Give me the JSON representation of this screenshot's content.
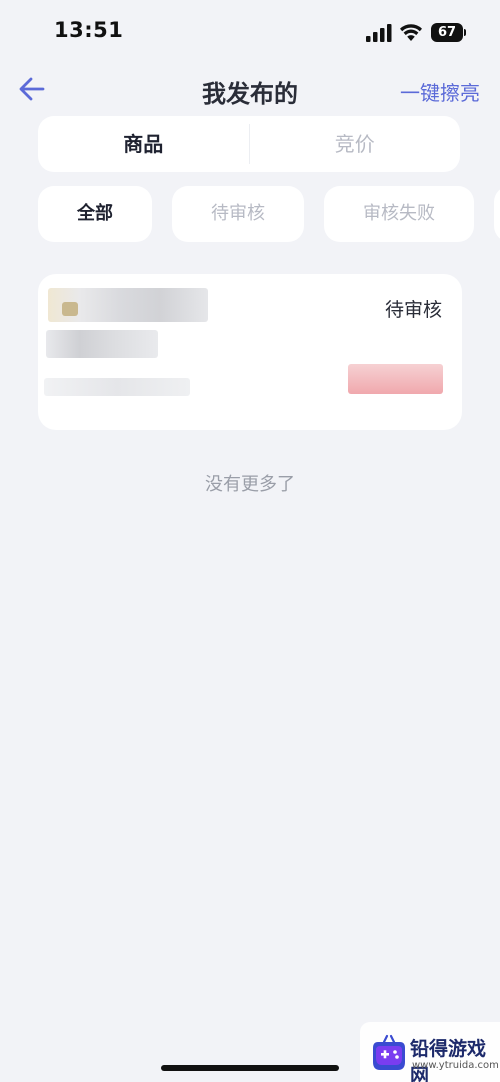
{
  "status_bar": {
    "time": "13:51",
    "battery_level": "67",
    "icons": [
      "signal-icon",
      "wifi-icon",
      "battery-icon"
    ]
  },
  "nav": {
    "title": "我发布的",
    "back_icon": "arrow-left-icon",
    "action_label": "一键擦亮"
  },
  "segment_tabs": [
    {
      "label": "商品",
      "active": true
    },
    {
      "label": "竞价",
      "active": false
    }
  ],
  "filter_chips": [
    {
      "label": "全部",
      "active": true
    },
    {
      "label": "待审核",
      "active": false
    },
    {
      "label": "审核失败",
      "active": false
    }
  ],
  "items": [
    {
      "status": "待审核"
    }
  ],
  "footer": {
    "end_text": "没有更多了"
  },
  "watermark": {
    "name": "铅得游戏网",
    "url": "www.ytruida.com"
  },
  "colors": {
    "background": "#f2f3f7",
    "accent": "#5b6ad8",
    "inactive_text": "#b7bac4",
    "price_blur": "#f0a8ad"
  }
}
